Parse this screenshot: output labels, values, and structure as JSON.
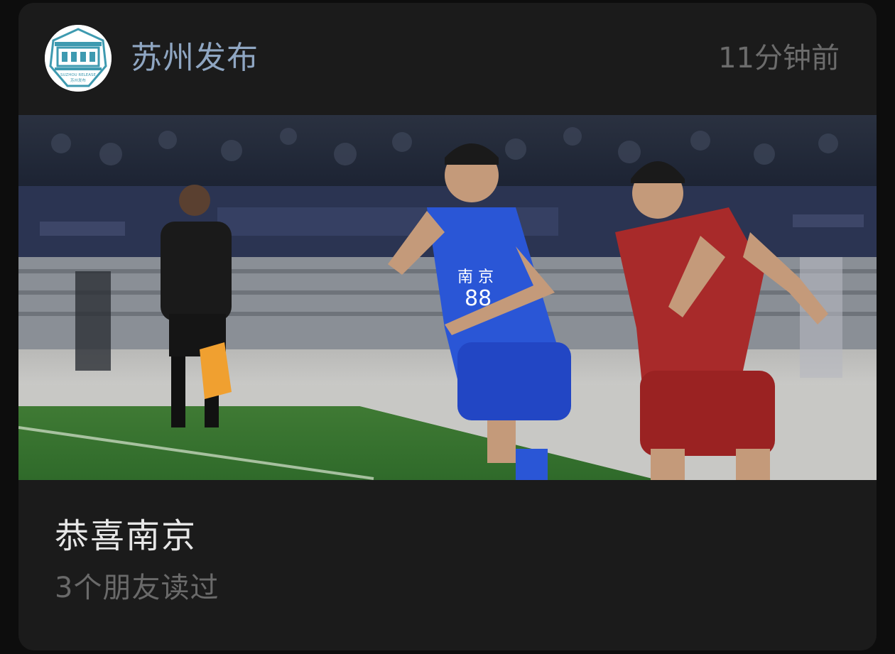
{
  "post": {
    "account_name": "苏州发布",
    "timestamp": "11分钟前",
    "avatar_logo": "suzhou-release-logo",
    "avatar_logo_text": "SUZHOU RELEASE 苏州发布",
    "image_description_icon": "football-match-photo",
    "article_title": "恭喜南京",
    "read_count": "3个朋友读过"
  },
  "colors": {
    "card_bg": "#1b1b1b",
    "page_bg": "#0d0d0d",
    "account_name": "#8fa6c2",
    "timestamp": "#6c6c6c",
    "title": "#e6e6e6",
    "read_count": "#6a6a6a",
    "logo_teal": "#3e9ab0"
  }
}
